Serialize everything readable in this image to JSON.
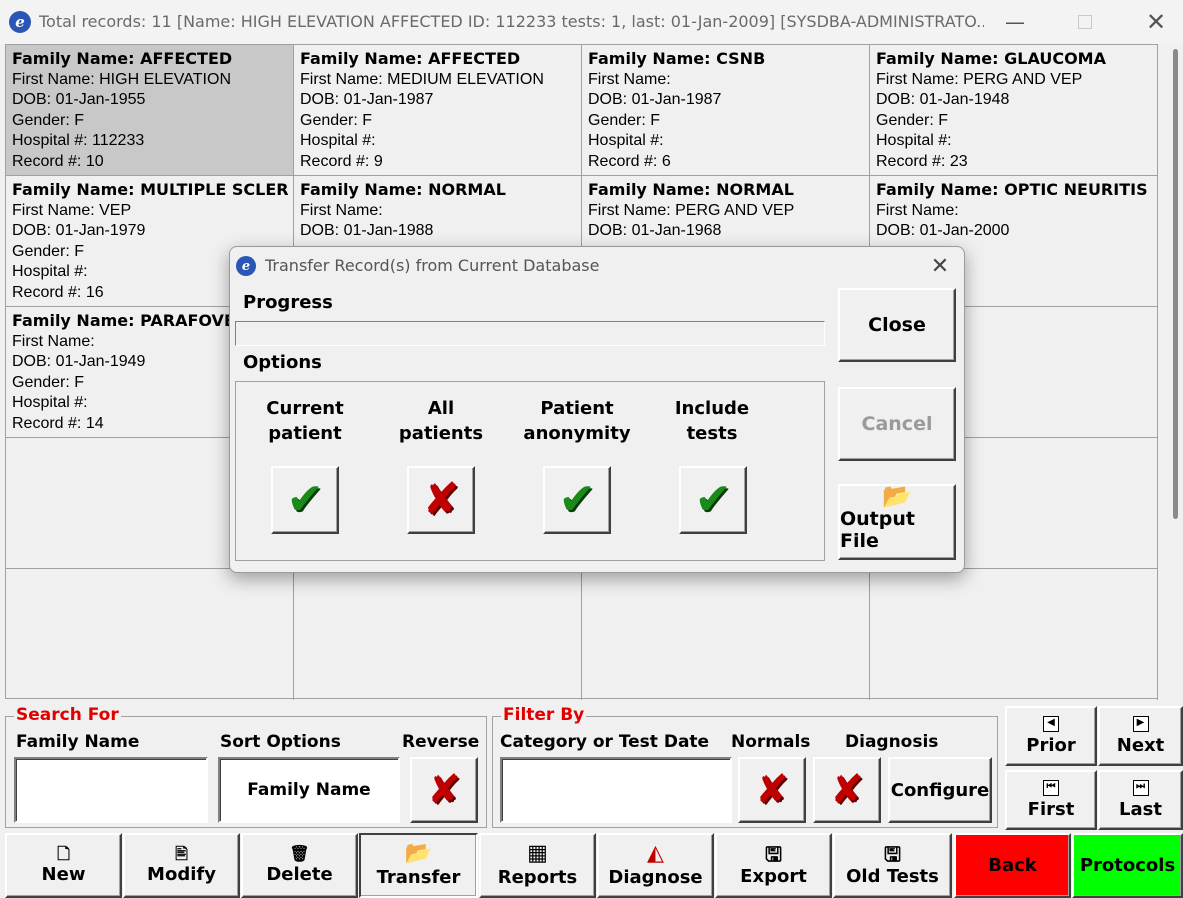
{
  "window": {
    "title": "Total records: 11  [Name: HIGH ELEVATION AFFECTED ID: 112233 tests: 1, last: 01-Jan-2009] [SYSDBA-ADMINISTRATO...",
    "logo_letter": "e",
    "minimize_glyph": "—",
    "close_glyph": "✕"
  },
  "records": [
    {
      "family": "Family Name: AFFECTED",
      "first": "First Name: HIGH ELEVATION",
      "dob": "DOB: 01-Jan-1955",
      "gender": "Gender: F",
      "hospital": "Hospital #: 112233",
      "record": "Record #: 10",
      "selected": true
    },
    {
      "family": "Family Name: AFFECTED",
      "first": "First Name: MEDIUM ELEVATION",
      "dob": "DOB: 01-Jan-1987",
      "gender": "Gender: F",
      "hospital": "Hospital #:",
      "record": "Record #: 9"
    },
    {
      "family": "Family Name: CSNB",
      "first": "First Name:",
      "dob": "DOB: 01-Jan-1987",
      "gender": "Gender: F",
      "hospital": "Hospital #:",
      "record": "Record #: 6"
    },
    {
      "family": "Family Name: GLAUCOMA",
      "first": "First Name: PERG AND VEP",
      "dob": "DOB: 01-Jan-1948",
      "gender": "Gender: F",
      "hospital": "Hospital #:",
      "record": "Record #: 23"
    },
    {
      "family": "Family Name: MULTIPLE SCLER",
      "first": "First Name: VEP",
      "dob": "DOB: 01-Jan-1979",
      "gender": "Gender: F",
      "hospital": "Hospital #:",
      "record": "Record #: 16"
    },
    {
      "family": "Family Name: NORMAL",
      "first": "First Name:",
      "dob": "DOB: 01-Jan-1988",
      "gender": "",
      "hospital": "",
      "record": ""
    },
    {
      "family": "Family Name: NORMAL",
      "first": "First Name: PERG AND VEP",
      "dob": "DOB: 01-Jan-1968",
      "gender": "",
      "hospital": "",
      "record": ""
    },
    {
      "family": "Family Name: OPTIC NEURITIS",
      "first": "First Name:",
      "dob": "DOB: 01-Jan-2000",
      "gender": "",
      "hospital": "",
      "record": ""
    },
    {
      "family": "Family Name: PARAFOVEA",
      "first": "First Name:",
      "dob": "DOB: 01-Jan-1949",
      "gender": "Gender: F",
      "hospital": "Hospital #:",
      "record": "Record #: 14"
    }
  ],
  "search": {
    "group_title": "Search For",
    "family_label": "Family Name",
    "family_value": "",
    "sort_label": "Sort Options",
    "sort_value": "Family Name",
    "reverse_label": "Reverse",
    "reverse_state": "off"
  },
  "filter": {
    "group_title": "Filter By",
    "category_label": "Category or Test Date",
    "category_value": "",
    "normals_label": "Normals",
    "normals_state": "off",
    "diagnosis_label": "Diagnosis",
    "diagnosis_state": "off",
    "configure_label": "Configure"
  },
  "nav": {
    "prior": "Prior",
    "next": "Next",
    "first": "First",
    "last": "Last"
  },
  "toolbar": {
    "new": "New",
    "modify": "Modify",
    "delete": "Delete",
    "transfer": "Transfer",
    "reports": "Reports",
    "diagnose": "Diagnose",
    "export": "Export",
    "old_tests": "Old Tests",
    "back": "Back",
    "protocols": "Protocols"
  },
  "colors": {
    "back_button": "#ff0000",
    "protocols_button": "#00ff00",
    "group_title": "#e00000"
  },
  "dialog": {
    "title": "Transfer Record(s) from Current Database",
    "progress_label": "Progress",
    "progress_value": 0,
    "options_label": "Options",
    "options": [
      {
        "label_line1": "Current",
        "label_line2": "patient",
        "state": "checked"
      },
      {
        "label_line1": "All",
        "label_line2": "patients",
        "state": "unchecked"
      },
      {
        "label_line1": "Patient",
        "label_line2": "anonymity",
        "state": "checked"
      },
      {
        "label_line1": "Include",
        "label_line2": "tests",
        "state": "checked"
      }
    ],
    "close_label": "Close",
    "cancel_label": "Cancel",
    "output_file_label": "Output File"
  }
}
